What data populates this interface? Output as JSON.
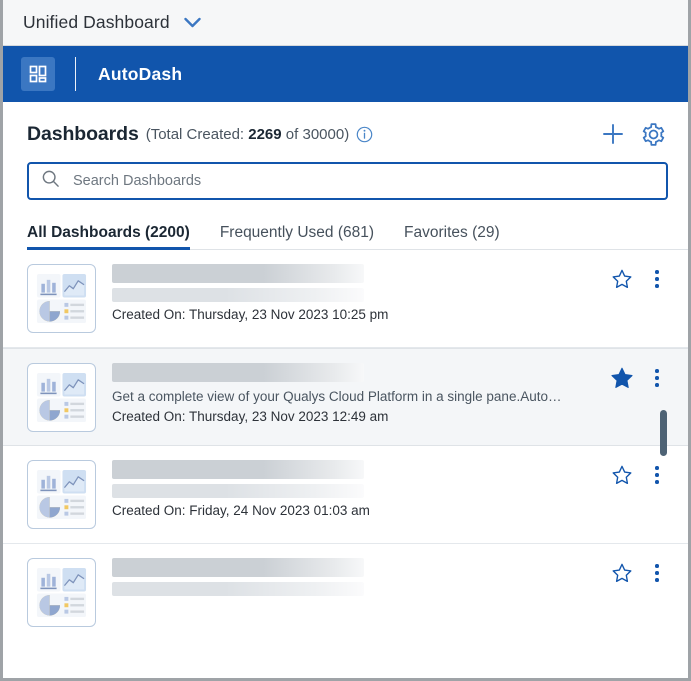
{
  "titlebar": {
    "title": "Unified Dashboard",
    "chevron_icon": "chevron-down-icon"
  },
  "appbar": {
    "logo_icon": "dashboard-grid-icon",
    "app_name": "AutoDash",
    "bg_color": "#1155ac"
  },
  "header": {
    "title": "Dashboards",
    "count_prefix": "(Total Created: ",
    "count_current": "2269",
    "count_middle": " of ",
    "count_max": "30000",
    "count_suffix": ")",
    "info_icon": "info-circle-icon",
    "add_icon": "plus-icon",
    "settings_icon": "gear-icon",
    "accent_color": "#1155ac"
  },
  "search": {
    "icon": "search-icon",
    "placeholder": "Search Dashboards",
    "value": ""
  },
  "tabs": [
    {
      "label": "All Dashboards (2200)",
      "active": true
    },
    {
      "label": "Frequently Used (681)",
      "active": false
    },
    {
      "label": "Favorites (29)",
      "active": false
    }
  ],
  "rows": [
    {
      "thumbnail_icon": "dashboard-thumbnail-icon",
      "title_redacted": true,
      "description": "",
      "date": "Created On: Thursday, 23 Nov 2023 10:25 pm",
      "favorite": false,
      "favorite_icon": "star-outline-icon",
      "menu_icon": "kebab-menu-icon",
      "selected": false
    },
    {
      "thumbnail_icon": "dashboard-thumbnail-icon",
      "title_redacted": true,
      "description": "Get a complete view of your Qualys Cloud Platform in a single pane.Auto…",
      "date": "Created On: Thursday, 23 Nov 2023 12:49 am",
      "favorite": true,
      "favorite_icon": "star-filled-icon",
      "menu_icon": "kebab-menu-icon",
      "selected": true
    },
    {
      "thumbnail_icon": "dashboard-thumbnail-icon",
      "title_redacted": true,
      "description": "",
      "date": "Created On: Friday, 24 Nov 2023 01:03 am",
      "favorite": false,
      "favorite_icon": "star-outline-icon",
      "menu_icon": "kebab-menu-icon",
      "selected": false
    },
    {
      "thumbnail_icon": "dashboard-thumbnail-icon",
      "title_redacted": true,
      "description": "",
      "date": "",
      "favorite": false,
      "favorite_icon": "star-outline-icon",
      "menu_icon": "kebab-menu-icon",
      "selected": false
    }
  ],
  "scrollbar": {
    "name": "vertical-scrollbar",
    "thumb_color": "#4e6375"
  }
}
